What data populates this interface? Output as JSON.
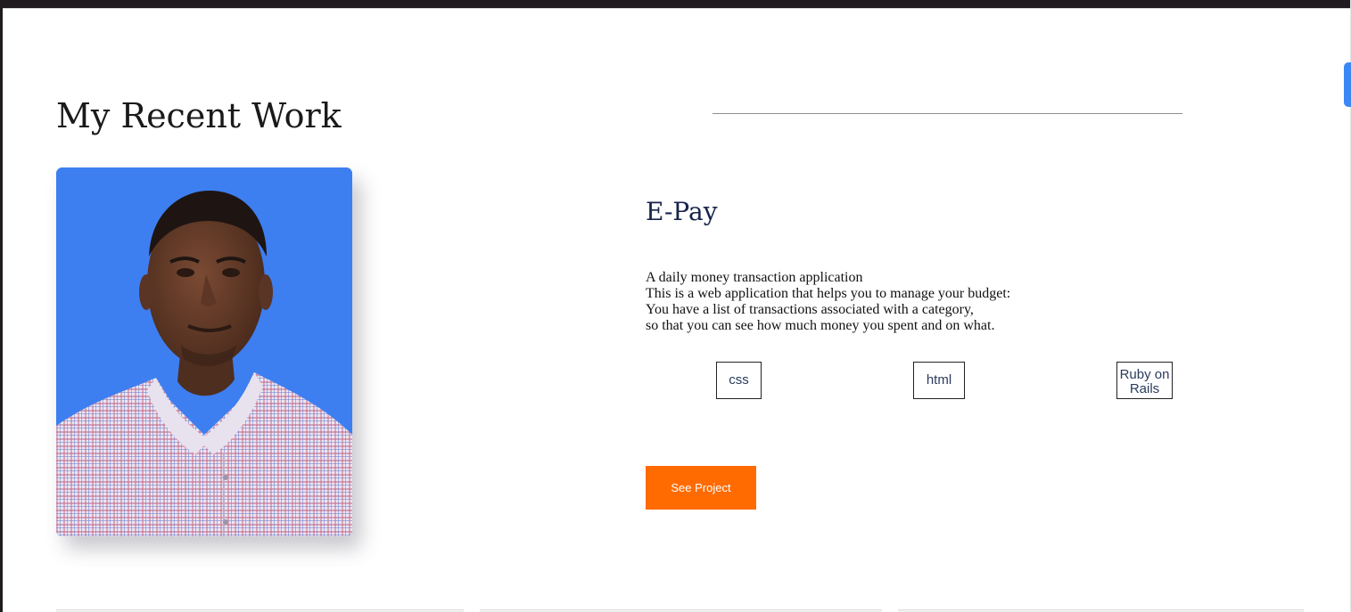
{
  "section": {
    "title": "My Recent Work"
  },
  "project": {
    "title": "E-Pay",
    "description_lines": [
      "A daily money transaction application",
      "This is a web application that helps you to manage your budget:",
      "You have a list of transactions associated with a category,",
      "so that you can see how much money you spent and on what."
    ],
    "tags": [
      "css",
      "html",
      "Ruby on Rails"
    ],
    "see_project_label": "See Project"
  },
  "colors": {
    "accent_button": "#ff6b00",
    "photo_background": "#3d7ff0",
    "title_color": "#172449",
    "scroll_indicator": "#3b88f5"
  }
}
